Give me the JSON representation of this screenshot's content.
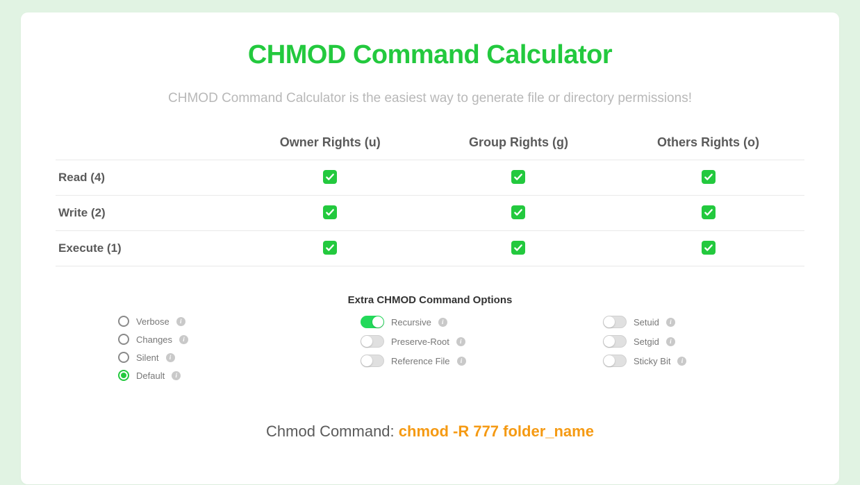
{
  "title": "CHMOD Command Calculator",
  "subtitle": "CHMOD Command Calculator is the easiest way to generate file or directory permissions!",
  "table": {
    "columns": [
      "",
      "Owner Rights (u)",
      "Group Rights (g)",
      "Others Rights (o)"
    ],
    "rows": [
      {
        "label": "Read (4)",
        "cells": [
          true,
          true,
          true
        ]
      },
      {
        "label": "Write (2)",
        "cells": [
          true,
          true,
          true
        ]
      },
      {
        "label": "Execute (1)",
        "cells": [
          true,
          true,
          true
        ]
      }
    ]
  },
  "extra_heading": "Extra CHMOD Command Options",
  "options": {
    "col1": [
      {
        "label": "Verbose",
        "type": "radio",
        "checked": false
      },
      {
        "label": "Changes",
        "type": "radio",
        "checked": false
      },
      {
        "label": "Silent",
        "type": "radio",
        "checked": false
      },
      {
        "label": "Default",
        "type": "radio",
        "checked": true
      }
    ],
    "col2": [
      {
        "label": "Recursive",
        "type": "toggle",
        "checked": true
      },
      {
        "label": "Preserve-Root",
        "type": "toggle",
        "checked": false
      },
      {
        "label": "Reference File",
        "type": "toggle",
        "checked": false
      }
    ],
    "col3": [
      {
        "label": "Setuid",
        "type": "toggle",
        "checked": false
      },
      {
        "label": "Setgid",
        "type": "toggle",
        "checked": false
      },
      {
        "label": "Sticky Bit",
        "type": "toggle",
        "checked": false
      }
    ]
  },
  "result": {
    "prefix": "Chmod Command: ",
    "command": "chmod -R 777 folder_name"
  },
  "colors": {
    "accent_green": "#23c93e",
    "accent_orange": "#f59a13"
  }
}
